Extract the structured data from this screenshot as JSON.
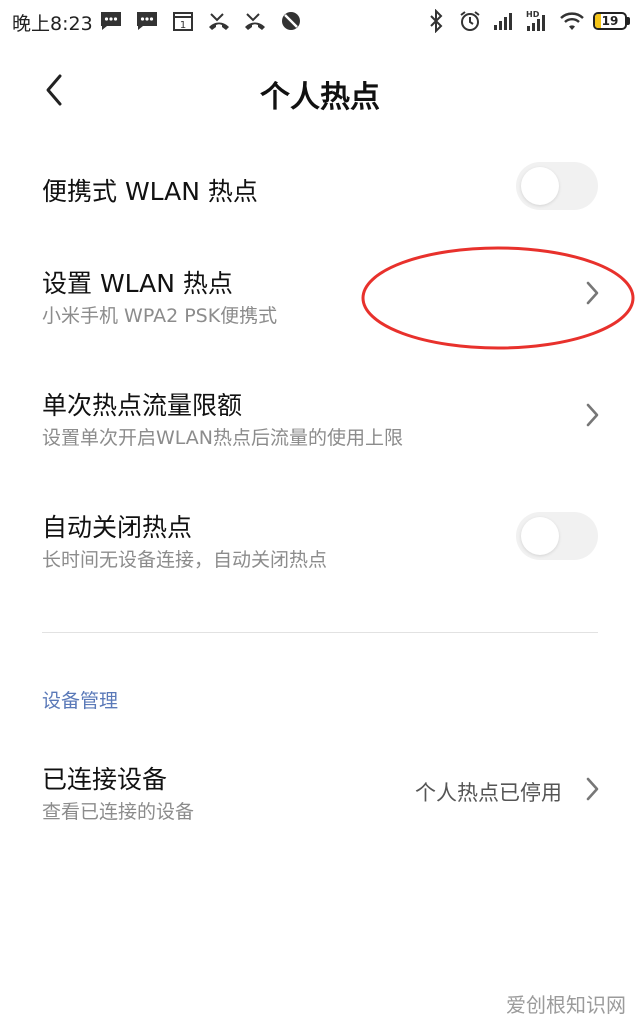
{
  "status_bar": {
    "time": "晚上8:23",
    "left_icons": [
      "message-icon",
      "message-icon",
      "calendar-icon",
      "missed-call-icon",
      "missed-call-icon",
      "dnd-icon"
    ],
    "right_icons": [
      "bluetooth-icon",
      "alarm-icon",
      "signal-icon",
      "hd-signal-icon",
      "wifi-icon"
    ],
    "calendar_day": "1",
    "hd_label": "HD",
    "battery": {
      "level": "19",
      "fill_fraction": 0.19,
      "color": "#f5c518"
    }
  },
  "header": {
    "back_icon": "chevron-left-icon",
    "title": "个人热点"
  },
  "rows": [
    {
      "title": "便携式 WLAN 热点",
      "control": "toggle",
      "toggle_on": false
    },
    {
      "title": "设置 WLAN 热点",
      "subtitle": "小米手机 WPA2 PSK便携式",
      "control": "chevron"
    },
    {
      "title": "单次热点流量限额",
      "subtitle": "设置单次开启WLAN热点后流量的使用上限",
      "control": "chevron"
    },
    {
      "title": "自动关闭热点",
      "subtitle": "长时间无设备连接，自动关闭热点",
      "control": "toggle",
      "toggle_on": false
    }
  ],
  "device_section": {
    "header": "设备管理",
    "header_color": "#5a79b8",
    "connected": {
      "title": "已连接设备",
      "subtitle": "查看已连接的设备",
      "value": "个人热点已停用",
      "control": "chevron"
    }
  },
  "annotation": {
    "shape": "ellipse",
    "color": "#e8312c"
  },
  "watermark": "爱创根知识网"
}
